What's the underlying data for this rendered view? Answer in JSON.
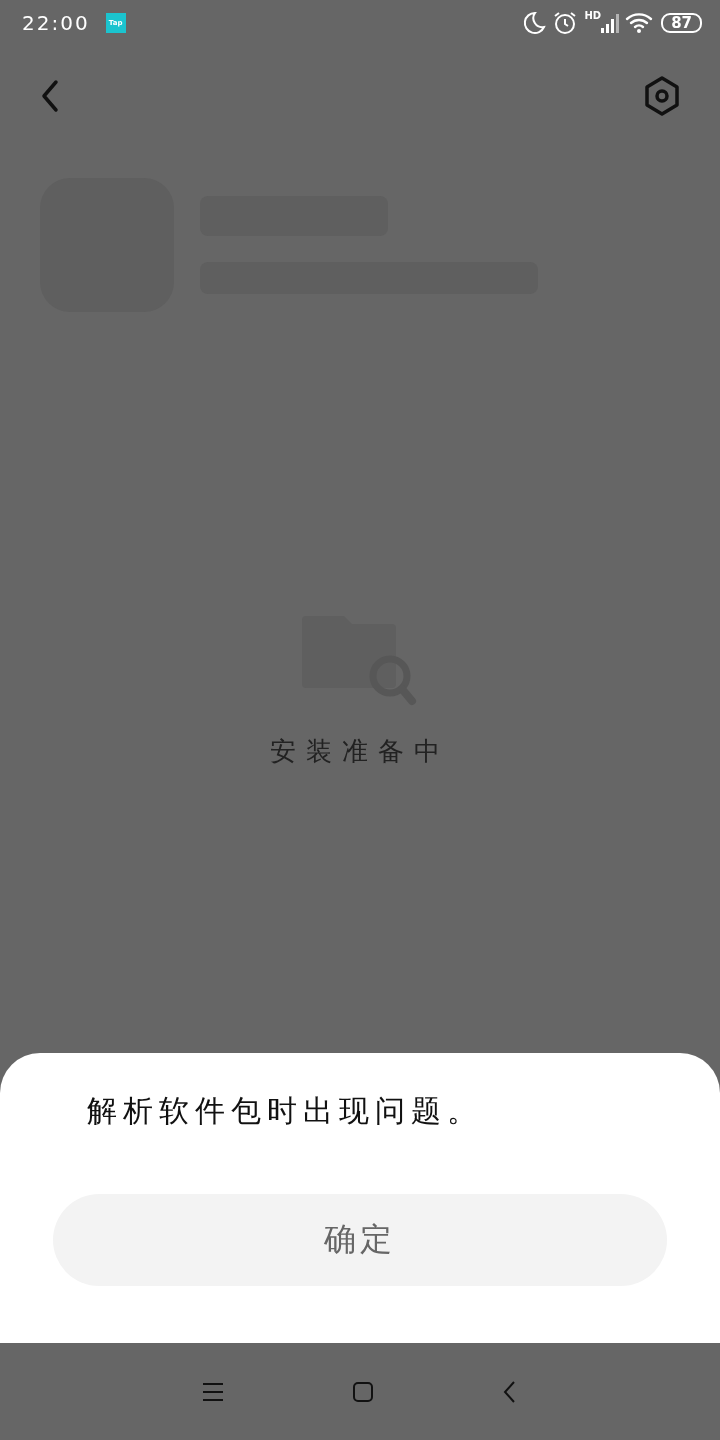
{
  "status_bar": {
    "time": "22:00",
    "app_badge": "Tap",
    "network_label": "HD",
    "battery": "87"
  },
  "empty_state": {
    "message": "安装准备中"
  },
  "dialog": {
    "message": "解析软件包时出现问题。",
    "button": "确定"
  },
  "nav_bar": {
    "buttons": [
      {
        "kind": "menu"
      },
      {
        "kind": "home"
      },
      {
        "kind": "back"
      }
    ]
  }
}
